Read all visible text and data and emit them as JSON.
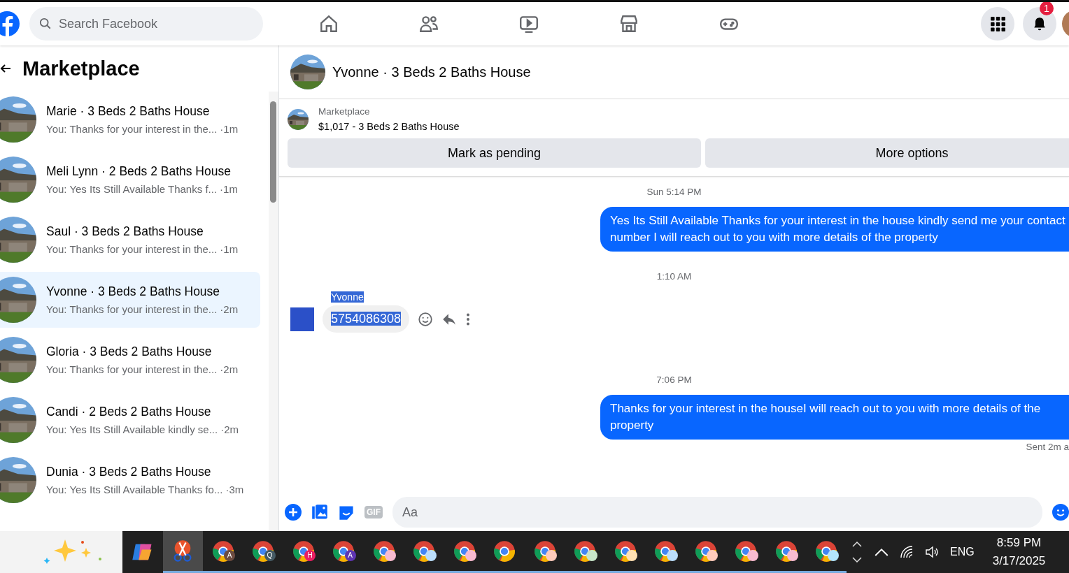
{
  "topbar": {
    "search": {
      "placeholder": "Search Facebook"
    },
    "nav": [
      {
        "kind": "home",
        "selected": false
      },
      {
        "kind": "friends",
        "selected": false
      },
      {
        "kind": "video",
        "selected": false
      },
      {
        "kind": "store",
        "selected": false
      },
      {
        "kind": "gaming",
        "selected": false
      }
    ],
    "notification_badge": "1"
  },
  "sidebar": {
    "title": "Marketplace",
    "conversations": [
      {
        "name": "Marie · 3 Beds 2 Baths House",
        "preview": "You: Thanks for your interest in the...",
        "time": "·1m",
        "selected": false
      },
      {
        "name": "Meli Lynn · 2 Beds 2 Baths House",
        "preview": "You: Yes Its Still Available Thanks f...",
        "time": "·1m",
        "selected": false
      },
      {
        "name": "Saul · 3 Beds 2 Baths House",
        "preview": "You: Thanks for your interest in the...",
        "time": "·1m",
        "selected": false
      },
      {
        "name": "Yvonne · 3 Beds 2 Baths House",
        "preview": "You: Thanks for your interest in the...",
        "time": "·2m",
        "selected": true
      },
      {
        "name": "Gloria · 3 Beds 2 Baths House",
        "preview": "You: Thanks for your interest in the...",
        "time": "·2m",
        "selected": false
      },
      {
        "name": "Candi · 2 Beds 2 Baths House",
        "preview": "You: Yes Its Still Available kindly se...",
        "time": "·2m",
        "selected": false
      },
      {
        "name": "Dunia · 3 Beds 2 Baths House",
        "preview": "You: Yes Its Still Available Thanks fo...",
        "time": "·3m",
        "selected": false
      }
    ]
  },
  "chat": {
    "title": "Yvonne · 3 Beds 2 Baths House",
    "listing": {
      "label": "Marketplace",
      "price_title": "$1,017 - 3 Beds 2 Baths House"
    },
    "actions": [
      "Mark as pending",
      "More options"
    ],
    "messages": [
      {
        "kind": "time",
        "text": "Sun 5:14 PM"
      },
      {
        "kind": "outgoing",
        "text": "Yes Its Still Available Thanks for your interest in the house kindly send me your contact number I will reach out to you with more details of the property"
      },
      {
        "kind": "time",
        "text": "1:10 AM"
      },
      {
        "kind": "incoming",
        "sender": "Yvonne",
        "text": "5754086308",
        "highlighted": true
      },
      {
        "kind": "time",
        "text": "7:06 PM"
      },
      {
        "kind": "outgoing",
        "text": "Thanks for your interest in the houseI will reach out to you with more details of the property"
      },
      {
        "kind": "status",
        "text": "Sent 2m a"
      }
    ],
    "composer": {
      "gif": "GIF",
      "placeholder": "Aa"
    }
  },
  "taskbar": {
    "apps": [
      {
        "kind": "copilot",
        "selected": false
      },
      {
        "kind": "snip",
        "selected": true
      },
      {
        "kind": "chrome",
        "badge": "A",
        "color": "#6d4c41",
        "selected": false
      },
      {
        "kind": "chrome",
        "badge": "Q",
        "color": "#455a64",
        "selected": false
      },
      {
        "kind": "chrome",
        "badge": "H",
        "color": "#e91e63",
        "selected": false
      },
      {
        "kind": "chrome",
        "badge": "A",
        "color": "#5e35b1",
        "selected": false
      },
      {
        "kind": "chrome",
        "color": "#f8bbd0",
        "selected": false
      },
      {
        "kind": "chrome",
        "color": "#bbdefb",
        "selected": false
      },
      {
        "kind": "chrome",
        "color": "#f8bbd0",
        "selected": false
      },
      {
        "kind": "chrome",
        "selected": false
      },
      {
        "kind": "chrome",
        "color": "#ffccbc",
        "selected": false
      },
      {
        "kind": "chrome",
        "color": "#c8e6c9",
        "selected": false
      },
      {
        "kind": "chrome",
        "color": "#ffe0b2",
        "selected": false
      },
      {
        "kind": "chrome",
        "color": "#bbdefb",
        "selected": false
      },
      {
        "kind": "chrome",
        "color": "#ffccbc",
        "selected": false
      },
      {
        "kind": "chrome",
        "color": "#f8bbd0",
        "selected": false
      },
      {
        "kind": "chrome",
        "color": "#f8bbd0",
        "selected": false
      },
      {
        "kind": "chrome",
        "color": "#b3e5fc",
        "selected": false
      }
    ],
    "language": "ENG",
    "time": "8:59 PM",
    "date": "3/17/2025"
  }
}
